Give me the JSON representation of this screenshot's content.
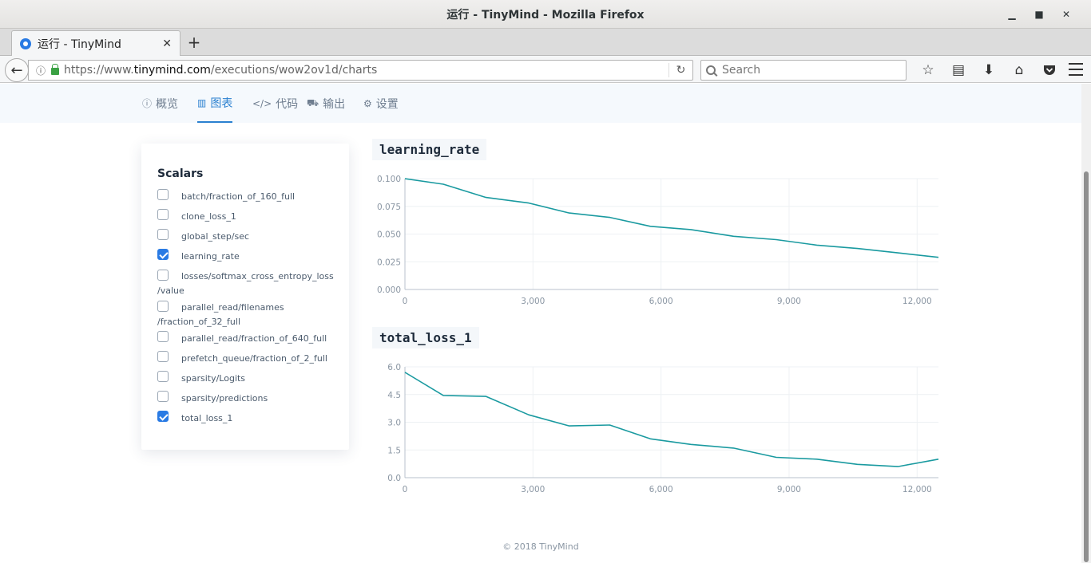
{
  "window": {
    "title": "运行 - TinyMind - Mozilla Firefox",
    "controls": [
      "▁",
      "■",
      "✕"
    ]
  },
  "tab": {
    "title": "运行 - TinyMind",
    "close": "✕",
    "new_tab": "+"
  },
  "nav": {
    "url_prefix": "https://www.",
    "url_domain": "tinymind.com",
    "url_path": "/executions/wow2ov1d/charts",
    "search_placeholder": "Search"
  },
  "toolbar_icons": [
    "bookmark-star-icon",
    "reader-icon",
    "download-icon",
    "home-icon",
    "pocket-icon"
  ],
  "subnav": {
    "items": [
      {
        "label": "概览",
        "icon": "ⓘ",
        "active": false
      },
      {
        "label": "图表",
        "icon": "▥",
        "active": true
      },
      {
        "label": "代码",
        "icon": "</>",
        "active": false
      },
      {
        "label": "输出",
        "icon": "⛟",
        "active": false
      },
      {
        "label": "设置",
        "icon": "⚙",
        "active": false
      }
    ]
  },
  "scalars": {
    "heading": "Scalars",
    "items": [
      {
        "label": "batch/fraction_of_160_full",
        "checked": false
      },
      {
        "label": "clone_loss_1",
        "checked": false
      },
      {
        "label": "global_step/sec",
        "checked": false
      },
      {
        "label": "learning_rate",
        "checked": true
      },
      {
        "label": "losses/softmax_cross_entropy_loss/value",
        "checked": false
      },
      {
        "label": "parallel_read/filenames/fraction_of_32_full",
        "checked": false
      },
      {
        "label": "parallel_read/fraction_of_640_full",
        "checked": false
      },
      {
        "label": "prefetch_queue/fraction_of_2_full",
        "checked": false
      },
      {
        "label": "sparsity/Logits",
        "checked": false
      },
      {
        "label": "sparsity/predictions",
        "checked": false
      },
      {
        "label": "total_loss_1",
        "checked": true
      }
    ]
  },
  "chart_data": [
    {
      "type": "line",
      "title": "learning_rate",
      "xlim": [
        0,
        12500
      ],
      "ylim": [
        0,
        0.1
      ],
      "xticks": [
        "0",
        "3,000",
        "6,000",
        "9,000",
        "12,000"
      ],
      "xtick_values": [
        0,
        3000,
        6000,
        9000,
        12000
      ],
      "yticks": [
        "0.000",
        "0.025",
        "0.050",
        "0.075",
        "0.100"
      ],
      "ytick_values": [
        0,
        0.025,
        0.05,
        0.075,
        0.1
      ],
      "grid": true,
      "color": "#1a9aa0",
      "series": [
        {
          "x": [
            0,
            900,
            1900,
            2900,
            3850,
            4800,
            5750,
            6700,
            7700,
            8700,
            9650,
            10600,
            11550,
            12500
          ],
          "y": [
            0.1,
            0.095,
            0.083,
            0.078,
            0.069,
            0.065,
            0.057,
            0.054,
            0.048,
            0.045,
            0.04,
            0.037,
            0.033,
            0.029
          ]
        }
      ]
    },
    {
      "type": "line",
      "title": "total_loss_1",
      "xlim": [
        0,
        12500
      ],
      "ylim": [
        0,
        6
      ],
      "xticks": [
        "0",
        "3,000",
        "6,000",
        "9,000",
        "12,000"
      ],
      "xtick_values": [
        0,
        3000,
        6000,
        9000,
        12000
      ],
      "yticks": [
        "0.0",
        "1.5",
        "3.0",
        "4.5",
        "6.0"
      ],
      "ytick_values": [
        0,
        1.5,
        3,
        4.5,
        6
      ],
      "grid": true,
      "color": "#1a9aa0",
      "series": [
        {
          "x": [
            0,
            900,
            1900,
            2900,
            3850,
            4800,
            5750,
            6700,
            7700,
            8700,
            9650,
            10600,
            11550,
            12500
          ],
          "y": [
            5.7,
            4.45,
            4.4,
            3.4,
            2.8,
            2.85,
            2.1,
            1.8,
            1.6,
            1.1,
            1.0,
            0.72,
            0.6,
            1.0
          ]
        }
      ]
    }
  ],
  "footer": "© 2018 TinyMind"
}
